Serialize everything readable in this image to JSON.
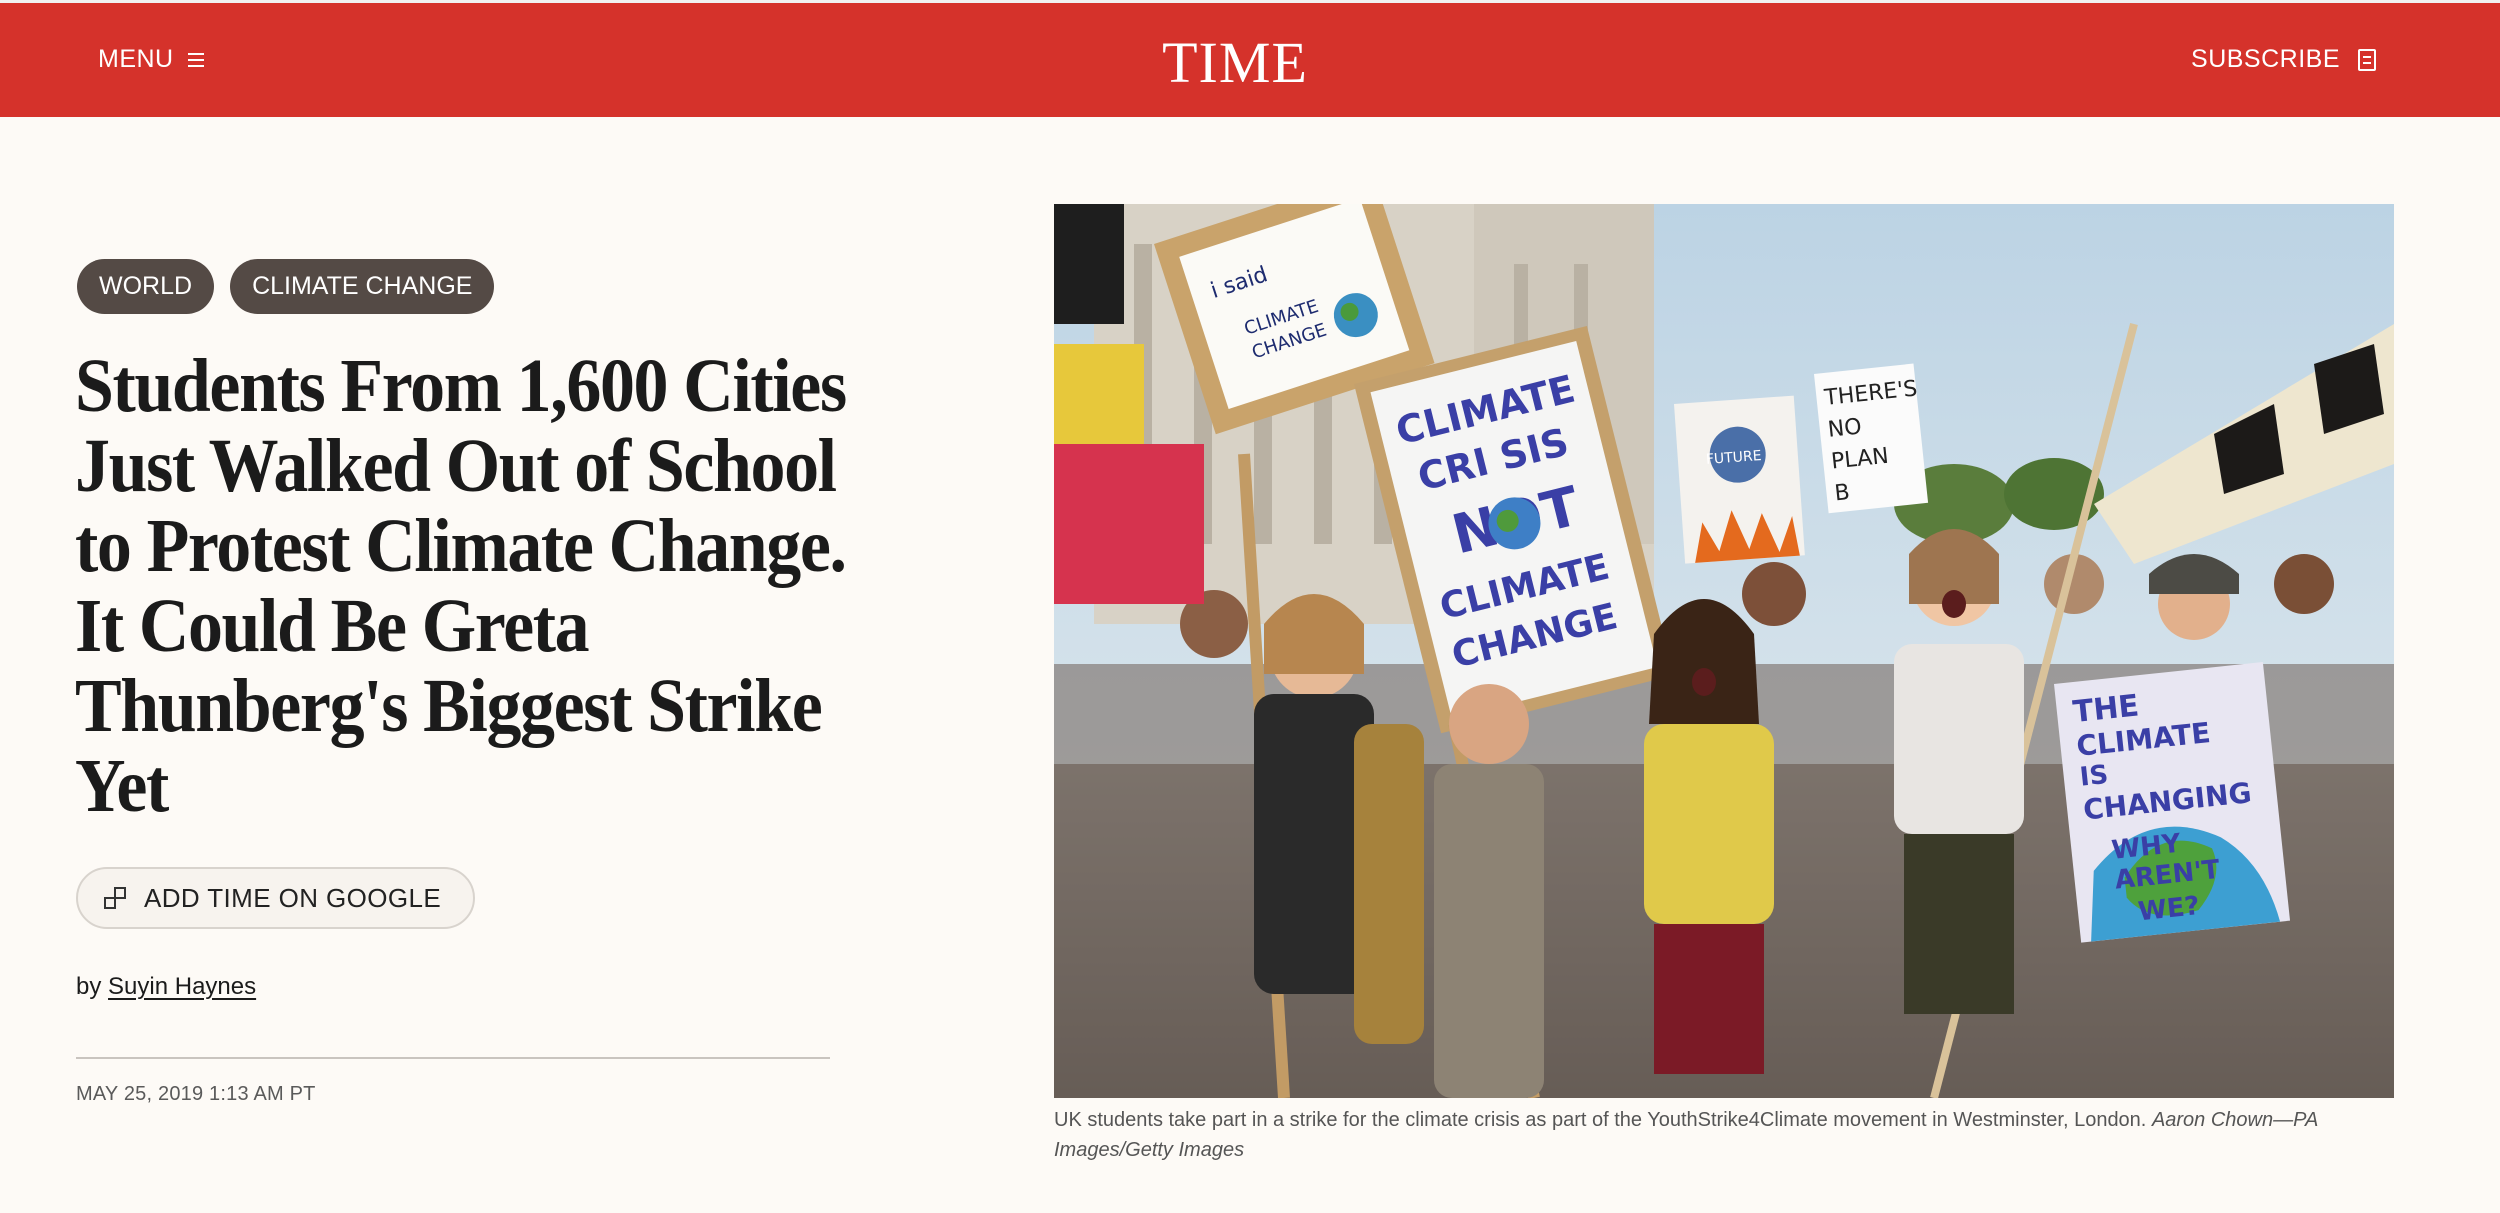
{
  "header": {
    "menu_label": "MENU",
    "logo_text": "TIME",
    "subscribe_label": "SUBSCRIBE",
    "brand_color": "#d5322b"
  },
  "tags": [
    {
      "label": "WORLD"
    },
    {
      "label": "CLIMATE CHANGE"
    }
  ],
  "article": {
    "headline": "Students From 1,600 Cities Just Walked Out of School to Protest Climate Change. It Could Be Greta Thunberg's Biggest Strike Yet",
    "google_button_label": "ADD TIME ON GOOGLE",
    "byline_prefix": "by",
    "author": "Suyin Haynes",
    "date": "MAY 25, 2019 1:13 AM PT"
  },
  "photo": {
    "sign_1_lines": [
      "i said",
      "CLIMATE",
      "CHANGE"
    ],
    "sign_2_lines": [
      "CLIMATE",
      "CRI SIS",
      "NOT",
      "CLIMATE",
      "CHANGE"
    ],
    "sign_3_lines": [
      "FUTURE"
    ],
    "sign_4_lines": [
      "THERE'S",
      "NO",
      "PLAN",
      "B"
    ],
    "sign_5_lines": [
      "THE",
      "CLIMATE",
      "IS",
      "CHANGING",
      "WHY",
      "AREN'T",
      "WE?"
    ]
  },
  "caption": {
    "text": "UK students take part in a strike for the climate crisis as part of the YouthStrike4Climate movement in Westminster, London.",
    "credit": "Aaron Chown—PA Images/Getty Images"
  }
}
